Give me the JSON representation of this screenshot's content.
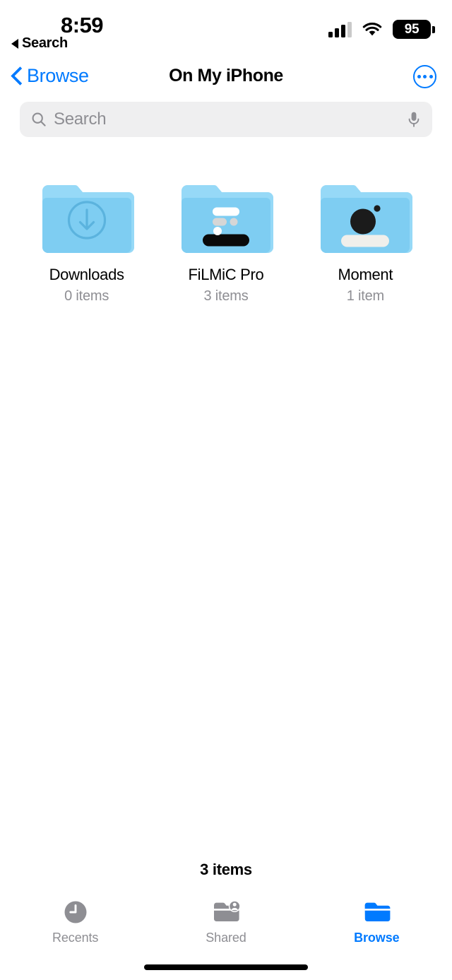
{
  "status_bar": {
    "time": "8:59",
    "back_to_app_label": "Search",
    "battery_percent": "95",
    "signal_icon": "cellular-bars-icon",
    "wifi_icon": "wifi-icon",
    "battery_icon": "battery-icon"
  },
  "nav_bar": {
    "back_label": "Browse",
    "title": "On My iPhone",
    "more_icon": "ellipsis-circle-icon",
    "back_chevron_icon": "chevron-left-icon"
  },
  "search": {
    "placeholder": "Search",
    "value": "",
    "search_icon": "magnifier-icon",
    "mic_icon": "microphone-icon"
  },
  "folders": [
    {
      "name": "Downloads",
      "count": "0 items",
      "badge_icon": "download-arrow-circle-icon",
      "tint": "#7ECDF2"
    },
    {
      "name": "FiLMiC Pro",
      "count": "3 items",
      "badge_icon": "filmic-pro-app-icon",
      "tint": "#7ECDF2"
    },
    {
      "name": "Moment",
      "count": "1 item",
      "badge_icon": "moment-camera-app-icon",
      "tint": "#7ECDF2"
    }
  ],
  "footer": {
    "item_count": "3 items"
  },
  "tab_bar": {
    "items": [
      {
        "label": "Recents",
        "icon": "clock-icon",
        "active": false
      },
      {
        "label": "Shared",
        "icon": "folder-person-icon",
        "active": false
      },
      {
        "label": "Browse",
        "icon": "folder-icon",
        "active": true
      }
    ]
  },
  "colors": {
    "accent": "#007aff",
    "folder_tint": "#7ECDF2",
    "folder_tab_tint": "#96D9F7",
    "inactive_gray": "#8e8e93",
    "search_bg": "#efeff0"
  }
}
